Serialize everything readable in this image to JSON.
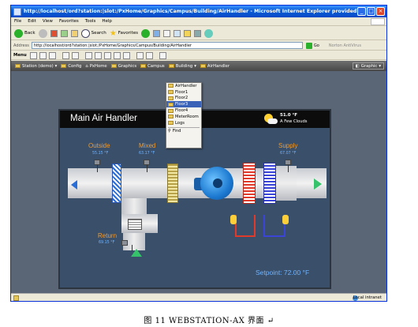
{
  "window": {
    "title": "http://localhost/ord?station:|slot:/PxHome/Graphics/Campus/Building/AirHandler - Microsoft Internet Explorer provided by Tridiu",
    "controls": {
      "minimize": "_",
      "maximize": "□",
      "close": "×"
    }
  },
  "menu": [
    "File",
    "Edit",
    "View",
    "Favorites",
    "Tools",
    "Help"
  ],
  "toolbar": {
    "back": "Back",
    "search": "Search",
    "favorites": "Favorites"
  },
  "address": {
    "label": "Address",
    "value": "http://localhost/ord?station:|slot:/PxHome/Graphics/Campus/Building/AirHandler",
    "go": "Go",
    "antivirus": "Norton AntiVirus"
  },
  "webtoolbar": {
    "menu": "Menu"
  },
  "nav": {
    "items": [
      "Station (demo)",
      "Config",
      "PxHome",
      "Graphics",
      "Campus",
      "Building",
      "AirHandler"
    ],
    "graphic": "Graphic"
  },
  "dropdown": {
    "items": [
      "AirHandler",
      "Floor1",
      "Floor2",
      "Floor3",
      "Floor4",
      "MeterRoom",
      "Logs"
    ],
    "selected": "Floor3",
    "find": "Find"
  },
  "panel": {
    "title": "Main Air Handler",
    "outside_temp": "51.0 °F",
    "conditions": "A Few Clouds",
    "outside_label": "Outside",
    "outside_value": "55.15 °F",
    "mixed_label": "Mixed",
    "mixed_value": "63.17 °F",
    "supply_label": "Supply",
    "supply_value": "67.07 °F",
    "return_label": "Return",
    "return_value": "69.15 °F",
    "setpoint": "Setpoint: 72.00 °F"
  },
  "status": {
    "zone": "Local intranet"
  },
  "caption": "图 11 WEBSTATION-AX 界面 ↵",
  "colors": {
    "title_blue": "#0a5fd8",
    "label_orange": "#f49a2a",
    "value_blue": "#6fb4ff",
    "fan_blue": "#1c79d0",
    "coil_red": "#e23a2a",
    "coil_blue": "#3a45d8"
  }
}
